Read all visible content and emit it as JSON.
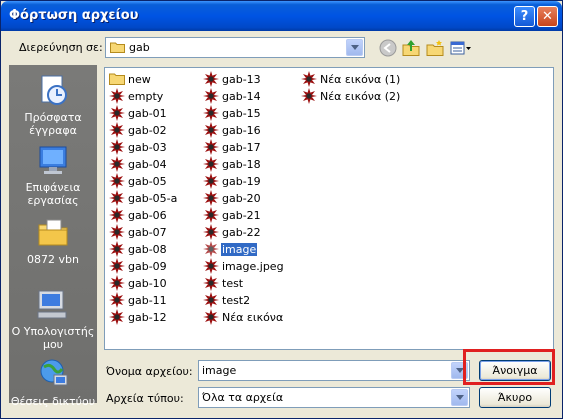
{
  "window": {
    "title": "Φόρτωση αρχείου",
    "help_glyph": "?",
    "close_glyph": "✕"
  },
  "lookin": {
    "label": "Διερεύνηση σε:",
    "value": "gab"
  },
  "toolbar": {
    "icons": [
      "back-icon",
      "up-folder-icon",
      "new-folder-icon",
      "view-menu-icon"
    ]
  },
  "places": [
    {
      "label": "Πρόσφατα έγγραφα",
      "icon": "recent-documents-icon"
    },
    {
      "label": "Επιφάνεια εργασίας",
      "icon": "desktop-icon"
    },
    {
      "label": "0872 vbn",
      "icon": "my-documents-icon"
    },
    {
      "label": "Ο Υπολογιστής μου",
      "icon": "my-computer-icon"
    },
    {
      "label": "Θέσεις δικτύου",
      "icon": "network-places-icon"
    }
  ],
  "files": {
    "columns": [
      [
        {
          "name": "new",
          "type": "folder"
        },
        {
          "name": "empty",
          "type": "image"
        },
        {
          "name": "gab-01",
          "type": "image"
        },
        {
          "name": "gab-02",
          "type": "image"
        },
        {
          "name": "gab-03",
          "type": "image"
        },
        {
          "name": "gab-04",
          "type": "image"
        },
        {
          "name": "gab-05",
          "type": "image"
        },
        {
          "name": "gab-05-a",
          "type": "image"
        },
        {
          "name": "gab-06",
          "type": "image"
        },
        {
          "name": "gab-07",
          "type": "image"
        },
        {
          "name": "gab-08",
          "type": "image"
        },
        {
          "name": "gab-09",
          "type": "image"
        },
        {
          "name": "gab-10",
          "type": "image"
        },
        {
          "name": "gab-11",
          "type": "image"
        },
        {
          "name": "gab-12",
          "type": "image"
        }
      ],
      [
        {
          "name": "gab-13",
          "type": "image"
        },
        {
          "name": "gab-14",
          "type": "image"
        },
        {
          "name": "gab-15",
          "type": "image"
        },
        {
          "name": "gab-16",
          "type": "image"
        },
        {
          "name": "gab-17",
          "type": "image"
        },
        {
          "name": "gab-18",
          "type": "image"
        },
        {
          "name": "gab-19",
          "type": "image"
        },
        {
          "name": "gab-20",
          "type": "image"
        },
        {
          "name": "gab-21",
          "type": "image"
        },
        {
          "name": "gab-22",
          "type": "image"
        },
        {
          "name": "image",
          "type": "image",
          "selected": true
        },
        {
          "name": "image.jpeg",
          "type": "image"
        },
        {
          "name": "test",
          "type": "image"
        },
        {
          "name": "test2",
          "type": "image"
        },
        {
          "name": "Νέα εικόνα",
          "type": "image"
        }
      ],
      [
        {
          "name": "Νέα εικόνα (1)",
          "type": "image"
        },
        {
          "name": "Νέα εικόνα (2)",
          "type": "image"
        }
      ]
    ]
  },
  "filename": {
    "label": "Όνομα αρχείου:",
    "value": "image"
  },
  "filetype": {
    "label": "Αρχεία τύπου:",
    "value": "Όλα τα αρχεία"
  },
  "buttons": {
    "open": "Άνοιγμα",
    "cancel": "Άκυρο"
  },
  "colors": {
    "highlight": "#e02020",
    "selection": "#316ac5",
    "title_bar": "#0054e3"
  }
}
